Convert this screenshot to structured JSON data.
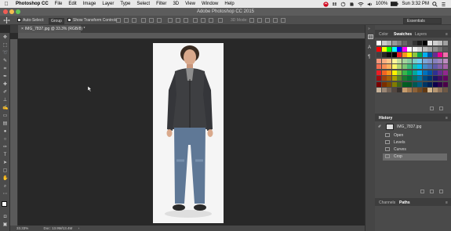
{
  "menubar": {
    "apple_glyph": "",
    "app": "Photoshop CC",
    "items": [
      "File",
      "Edit",
      "Image",
      "Layer",
      "Type",
      "Select",
      "Filter",
      "3D",
      "View",
      "Window",
      "Help"
    ],
    "battery": "100%",
    "clock": "Sun 3:32 PM"
  },
  "window": {
    "title": "Adobe Photoshop CC 2015"
  },
  "options": {
    "auto_select_label": "Auto-Select:",
    "group_value": "Group",
    "show_transform_label": "Show Transform Controls",
    "mode_3d_label": "3D Mode:",
    "workspace": "Essentials"
  },
  "document": {
    "tab_label": "IMG_7837.jpg @ 33.3% (RGB/8) *",
    "zoom": "33.33%",
    "doc_size": "Doc: 13.9M/13.4M"
  },
  "panels": {
    "top_tabs": [
      "Color",
      "Swatches",
      "Layers"
    ],
    "history_title": "History",
    "history_snapshot": "IMG_7837.jpg",
    "history_steps": [
      "Open",
      "Levels",
      "Curves",
      "Crop"
    ],
    "bottom_tabs": [
      "Channels",
      "Paths"
    ]
  },
  "colors": {
    "accent_active": "#6b6b6b",
    "swatch_rows": [
      [
        "#ffffff",
        "#cccccc",
        "#b3b3b3",
        "#999999",
        "#808080",
        "#666666",
        "#4d4d4d",
        "#333333",
        "#1a1a1a",
        "#000000",
        "#e6e6e6",
        "#cfcfcf",
        "#bdbdbd",
        "#a0a0a0"
      ],
      [
        "#ff0000",
        "#ffff00",
        "#00ff00",
        "#00ffff",
        "#0000ff",
        "#ff00ff",
        "#ffffff",
        "#f2f2f2",
        "#d9d9d9",
        "#bfbfbf",
        "#a6a6a6",
        "#8c8c8c",
        "#737373",
        "#595959"
      ],
      [
        "#404040",
        "#262626",
        "#0d0d0d",
        "#000000",
        "#ed1c24",
        "#f7941d",
        "#fff200",
        "#8dc63f",
        "#00a651",
        "#00aeef",
        "#0054a6",
        "#662d91",
        "#ec008c",
        "#f06eaa"
      ],
      [
        "#f69679",
        "#f9ad81",
        "#fdc689",
        "#fff799",
        "#c4df9b",
        "#a3d39c",
        "#82ca9c",
        "#7accc8",
        "#6dcff6",
        "#7da7d9",
        "#8393ca",
        "#8781bd",
        "#a186be",
        "#bd8cbf"
      ],
      [
        "#f26c4f",
        "#f68e55",
        "#fbaf5c",
        "#fff467",
        "#acd372",
        "#7cc576",
        "#3bb878",
        "#1abbb4",
        "#00bff3",
        "#438ccb",
        "#5574b9",
        "#605ca8",
        "#855fa8",
        "#a763a8"
      ],
      [
        "#ed1c24",
        "#f26522",
        "#f7941d",
        "#fff200",
        "#8dc73f",
        "#39b54a",
        "#00a651",
        "#00a99d",
        "#00aeef",
        "#0072bc",
        "#0054a6",
        "#2e3192",
        "#662d91",
        "#92278f"
      ],
      [
        "#9e0b0f",
        "#a0410d",
        "#a36209",
        "#aba000",
        "#598527",
        "#1a7b30",
        "#007236",
        "#00746b",
        "#0076a3",
        "#004b80",
        "#003471",
        "#1b1464",
        "#440e62",
        "#630460"
      ],
      [
        "#790000",
        "#7b2e00",
        "#7d4900",
        "#827b00",
        "#406618",
        "#005e20",
        "#005826",
        "#005952",
        "#005b7f",
        "#003663",
        "#002157",
        "#0d004c",
        "#32004b",
        "#4b0049"
      ],
      [
        "#c7b299",
        "#998675",
        "#736357",
        "#534741",
        "#37302d",
        "#c69c6d",
        "#a67c52",
        "#8c6239",
        "#754c24",
        "#603913",
        "#d7b98e",
        "#b59672",
        "#8f735a",
        "#6d5845"
      ]
    ]
  }
}
